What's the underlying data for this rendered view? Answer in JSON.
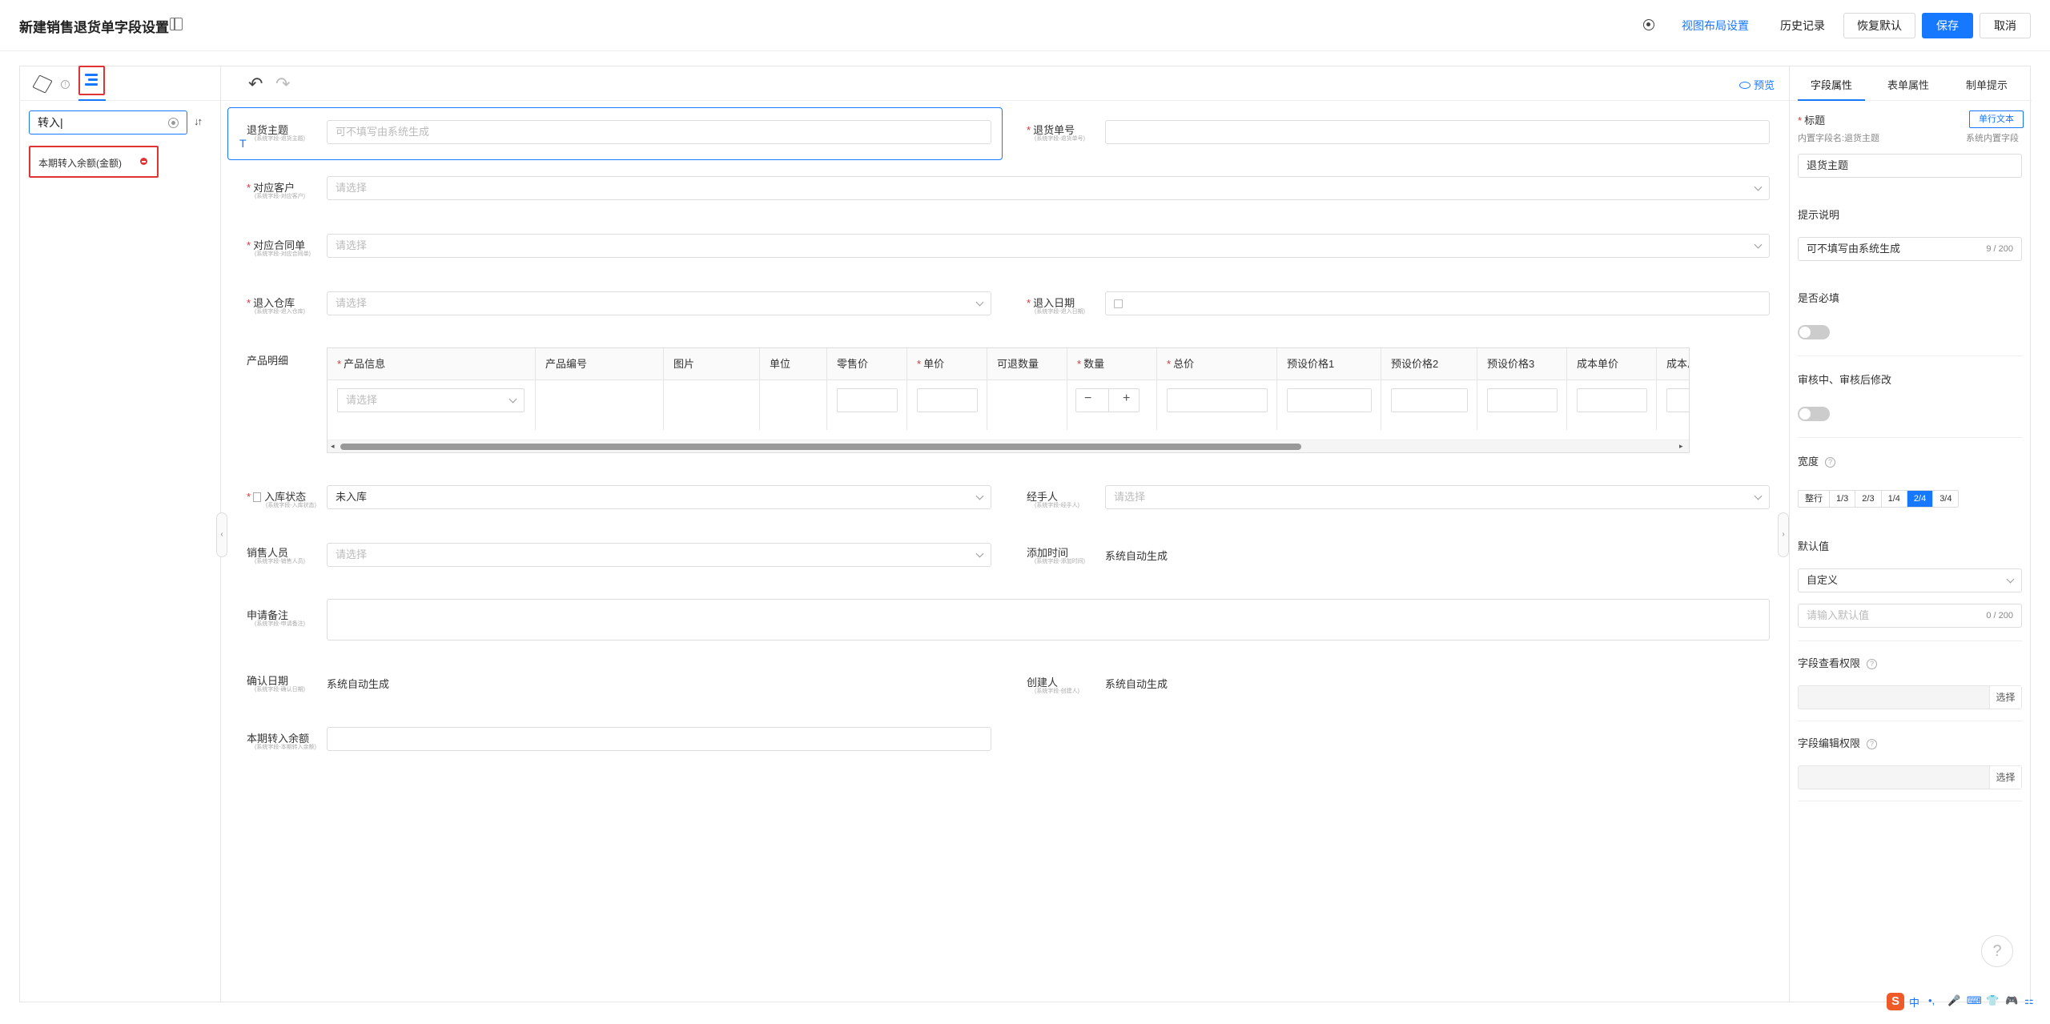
{
  "header": {
    "title": "新建销售退货单字段设置",
    "view_layout": "视图布局设置",
    "history": "历史记录",
    "restore_default": "恢复默认",
    "save": "保存",
    "cancel": "取消"
  },
  "left_panel": {
    "search_value": "转入|",
    "result_item": "本期转入余额(金额)"
  },
  "toolbar": {
    "preview": "预览"
  },
  "form": {
    "subject": {
      "label": "退货主题",
      "sub": "(系统字段-退货主题)",
      "placeholder": "可不填写由系统生成"
    },
    "order_no": {
      "label": "退货单号",
      "sub": "(系统字段-退货单号)"
    },
    "customer": {
      "label": "对应客户",
      "sub": "(系统字段-对应客户)",
      "placeholder": "请选择"
    },
    "contract": {
      "label": "对应合同单",
      "sub": "(系统字段-对应合同单)",
      "placeholder": "请选择"
    },
    "warehouse": {
      "label": "退入仓库",
      "sub": "(系统字段-退入仓库)",
      "placeholder": "请选择"
    },
    "return_date": {
      "label": "退入日期",
      "sub": "(系统字段-退入日期)"
    },
    "product_detail": {
      "label": "产品明细",
      "select_placeholder": "请选择"
    },
    "stock_status": {
      "label": "入库状态",
      "sub": "(系统字段-入库状态)",
      "value": "未入库"
    },
    "handler": {
      "label": "经手人",
      "sub": "(系统字段-经手人)",
      "placeholder": "请选择"
    },
    "salesperson": {
      "label": "销售人员",
      "sub": "(系统字段-销售人员)",
      "placeholder": "请选择"
    },
    "add_time": {
      "label": "添加时间",
      "sub": "(系统字段-添加时间)",
      "value": "系统自动生成"
    },
    "remark": {
      "label": "申请备注",
      "sub": "(系统字段-申请备注)"
    },
    "confirm_date": {
      "label": "确认日期",
      "sub": "(系统字段-确认日期)",
      "value": "系统自动生成"
    },
    "creator": {
      "label": "创建人",
      "sub": "(系统字段-创建人)",
      "value": "系统自动生成"
    },
    "balance": {
      "label": "本期转入余额",
      "sub": "(系统字段-本期转入余额)"
    }
  },
  "product_table": {
    "columns": [
      "产品信息",
      "产品编号",
      "图片",
      "单位",
      "零售价",
      "单价",
      "可退数量",
      "数量",
      "总价",
      "预设价格1",
      "预设价格2",
      "预设价格3",
      "成本单价",
      "成本总价"
    ],
    "required": [
      true,
      false,
      false,
      false,
      false,
      true,
      false,
      true,
      true,
      false,
      false,
      false,
      false,
      false
    ],
    "minus": "−",
    "plus": "+"
  },
  "right_panel": {
    "tabs": [
      "字段属性",
      "表单属性",
      "制单提示"
    ],
    "title_label": "标题",
    "tag": "单行文本",
    "builtin_name": "内置字段名:退货主题",
    "builtin_field": "系统内置字段",
    "title_value": "退货主题",
    "hint_label": "提示说明",
    "hint_value": "可不填写由系统生成",
    "hint_count": "9 / 200",
    "required_label": "是否必填",
    "edit_label": "审核中、审核后修改",
    "width_label": "宽度",
    "width_options": [
      "整行",
      "1/3",
      "2/3",
      "1/4",
      "2/4",
      "3/4"
    ],
    "width_selected": "2/4",
    "default_label": "默认值",
    "default_type": "自定义",
    "default_placeholder": "请输入默认值",
    "default_count": "0 / 200",
    "view_perm_label": "字段查看权限",
    "edit_perm_label": "字段编辑权限",
    "select": "选择"
  },
  "ime": {
    "items": [
      "中",
      "•,",
      "🎤",
      "⌨",
      "👕",
      "🎮",
      "⚏"
    ]
  },
  "colors": {
    "accent": "#1677ff",
    "highlight": "#e03333"
  }
}
